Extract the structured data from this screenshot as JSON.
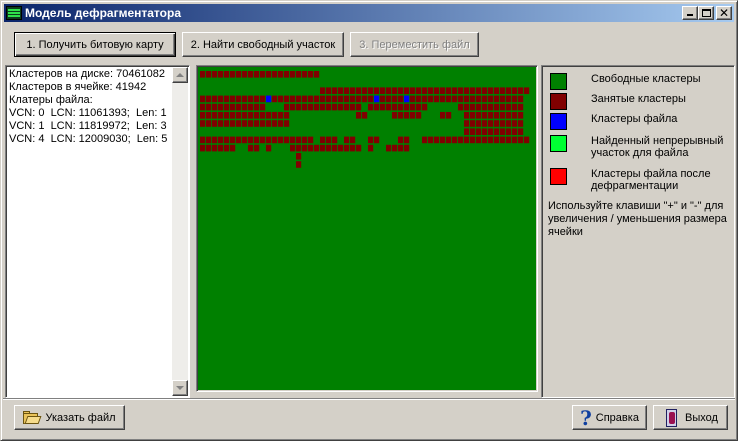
{
  "window": {
    "title": "Модель дефрагментатора",
    "controls": {
      "minimize_icon": "minimize-icon",
      "maximize_icon": "maximize-icon",
      "close_icon": "close-icon",
      "close_glyph": "✕"
    }
  },
  "toolbar": {
    "get_bitmap_label": "1. Получить битовую карту",
    "find_free_label": "2. Найти свободный участок",
    "move_file_label": "3. Переместить файл"
  },
  "info": {
    "lines": [
      "Кластеров на диске: 70461082",
      "Кластеров в ячейке: 41942",
      "Клатеры файла:",
      "VCN: 0  LCN: 11061393;  Len: 1",
      "VCN: 1  LCN: 11819972;  Len: 3",
      "VCN: 4  LCN: 12009030;  Len: 5"
    ]
  },
  "map": {
    "colors": {
      "free": "#008000",
      "used": "#800000",
      "file": "#0000ff"
    },
    "cols": 55,
    "used_runs": [
      [
        0,
        0,
        20
      ],
      [
        2,
        20,
        48
      ],
      [
        3,
        0,
        54
      ],
      [
        4,
        0,
        11
      ],
      [
        4,
        14,
        13
      ],
      [
        4,
        28,
        10
      ],
      [
        4,
        43,
        11
      ],
      [
        5,
        0,
        15
      ],
      [
        5,
        26,
        2
      ],
      [
        5,
        32,
        5
      ],
      [
        5,
        40,
        2
      ],
      [
        5,
        44,
        10
      ],
      [
        6,
        0,
        15
      ],
      [
        6,
        44,
        10
      ],
      [
        7,
        44,
        10
      ],
      [
        8,
        0,
        19
      ],
      [
        8,
        20,
        3
      ],
      [
        8,
        24,
        2
      ],
      [
        8,
        28,
        2
      ],
      [
        8,
        33,
        2
      ],
      [
        8,
        37,
        18
      ],
      [
        9,
        0,
        6
      ],
      [
        9,
        8,
        2
      ],
      [
        9,
        11,
        1
      ],
      [
        9,
        15,
        12
      ],
      [
        9,
        28,
        1
      ],
      [
        9,
        31,
        4
      ],
      [
        10,
        16,
        1
      ],
      [
        11,
        16,
        1
      ]
    ],
    "file_cells": [
      [
        3,
        11
      ],
      [
        3,
        29
      ],
      [
        3,
        34
      ]
    ]
  },
  "legend": {
    "items": [
      {
        "id": "free",
        "color": "#008000",
        "label": "Свободные кластеры"
      },
      {
        "id": "used",
        "color": "#800000",
        "label": "Занятые кластеры"
      },
      {
        "id": "file",
        "color": "#0000ff",
        "label": "Кластеры файла"
      },
      {
        "id": "found",
        "color": "#00ff33",
        "label": "Найденный непрерывный участок для файла"
      },
      {
        "id": "after",
        "color": "#ff0000",
        "label": "Кластеры файла после дефрагментации"
      }
    ],
    "hint": "Используйте клавиши \"+\" и \"-\" для увеличения / уменьшения размера ячейки"
  },
  "footer": {
    "choose_file_label": "Указать файл",
    "help_label": "Справка",
    "exit_label": "Выход"
  }
}
